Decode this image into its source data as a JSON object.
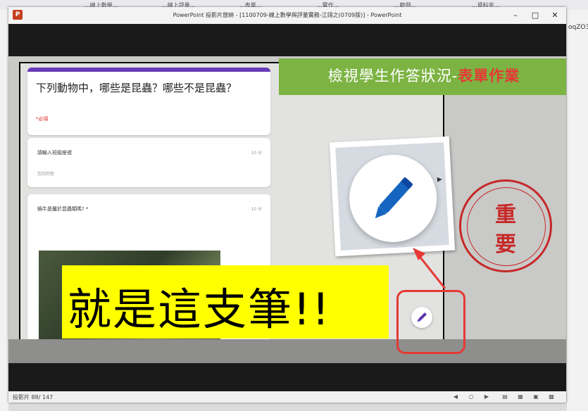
{
  "background_tabs": [
    {
      "label": "...線上數學..."
    },
    {
      "label": "...線上評量..."
    },
    {
      "label": "...表單..."
    },
    {
      "label": "...實作..."
    },
    {
      "label": "...範例..."
    },
    {
      "label": "...資料夾..."
    }
  ],
  "background_right_text": "oqZO3",
  "window": {
    "title": "PowerPoint 投影片放映 - [1100709-線上數學與評量實務-江翊之(0709版)] - PowerPoint",
    "app_icon": "powerpoint-icon",
    "controls": [
      "minimize-icon",
      "maximize-icon",
      "close-icon"
    ]
  },
  "form": {
    "question_title": "下列動物中，哪些是昆蟲？哪些不是昆蟲？",
    "required": "*必填",
    "q1_label": "請輸入班級座號",
    "q1_points": "10 分",
    "q1_placeholder": "您的回答",
    "q2_label": "蝸牛是屬於昆蟲類嗎? *",
    "q2_points": "10 分"
  },
  "banner": {
    "text": "檢視學生作答狀況-",
    "highlight": "表單作業"
  },
  "callout": {
    "text": "就是這支筆!!"
  },
  "stamp": {
    "line1": "重",
    "line2": "要"
  },
  "status_bar": {
    "slide_counter": "投影片 88/ 147",
    "icons": [
      "prev-icon",
      "menu-icon",
      "next-icon",
      "normal-view-icon",
      "sorter-view-icon",
      "reading-view-icon",
      "slideshow-icon"
    ]
  },
  "colors": {
    "accent_form": "#673ab7",
    "banner_bg": "#7cb342",
    "highlight_red": "#e53935",
    "callout_bg": "#ffff00",
    "stamp_red": "#c62828",
    "pencil_blue": "#1565c0"
  }
}
